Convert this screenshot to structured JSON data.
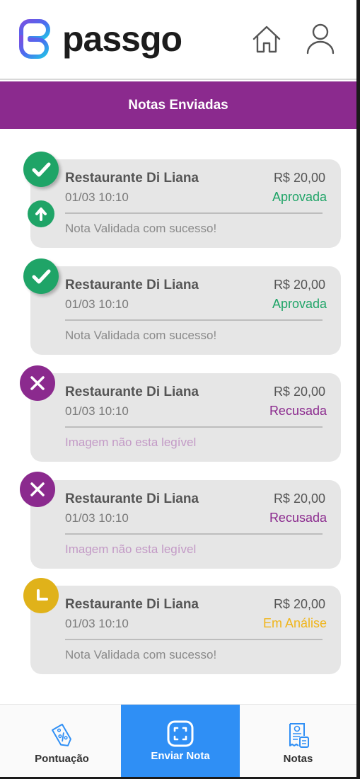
{
  "header": {
    "brand": "passgo",
    "icons": {
      "home": "home-icon",
      "user": "user-icon"
    }
  },
  "page_title": "Notas Enviadas",
  "colors": {
    "purple": "#8b2a8e",
    "green": "#1fa467",
    "yellow": "#f0b51b",
    "blue": "#2f8ff5"
  },
  "notes": [
    {
      "store": "Restaurante Di Liana",
      "datetime": "01/03 10:10",
      "amount": "R$ 20,00",
      "status": "Aprovada",
      "message": "Nota Validada com sucesso!"
    },
    {
      "store": "Restaurante Di Liana",
      "datetime": "01/03 10:10",
      "amount": "R$ 20,00",
      "status": "Aprovada",
      "message": "Nota Validada com sucesso!"
    },
    {
      "store": "Restaurante Di Liana",
      "datetime": "01/03 10:10",
      "amount": "R$ 20,00",
      "status": "Recusada",
      "message": "Imagem não esta legível"
    },
    {
      "store": "Restaurante Di Liana",
      "datetime": "01/03 10:10",
      "amount": "R$ 20,00",
      "status": "Recusada",
      "message": "Imagem não esta legível"
    },
    {
      "store": "Restaurante Di Liana",
      "datetime": "01/03 10:10",
      "amount": "R$ 20,00",
      "status": "Em Análise",
      "message": "Nota Validada com sucesso!"
    }
  ],
  "bottom_nav": {
    "pontuacao": "Pontuação",
    "enviar_nota": "Enviar Nota",
    "notas": "Notas"
  }
}
